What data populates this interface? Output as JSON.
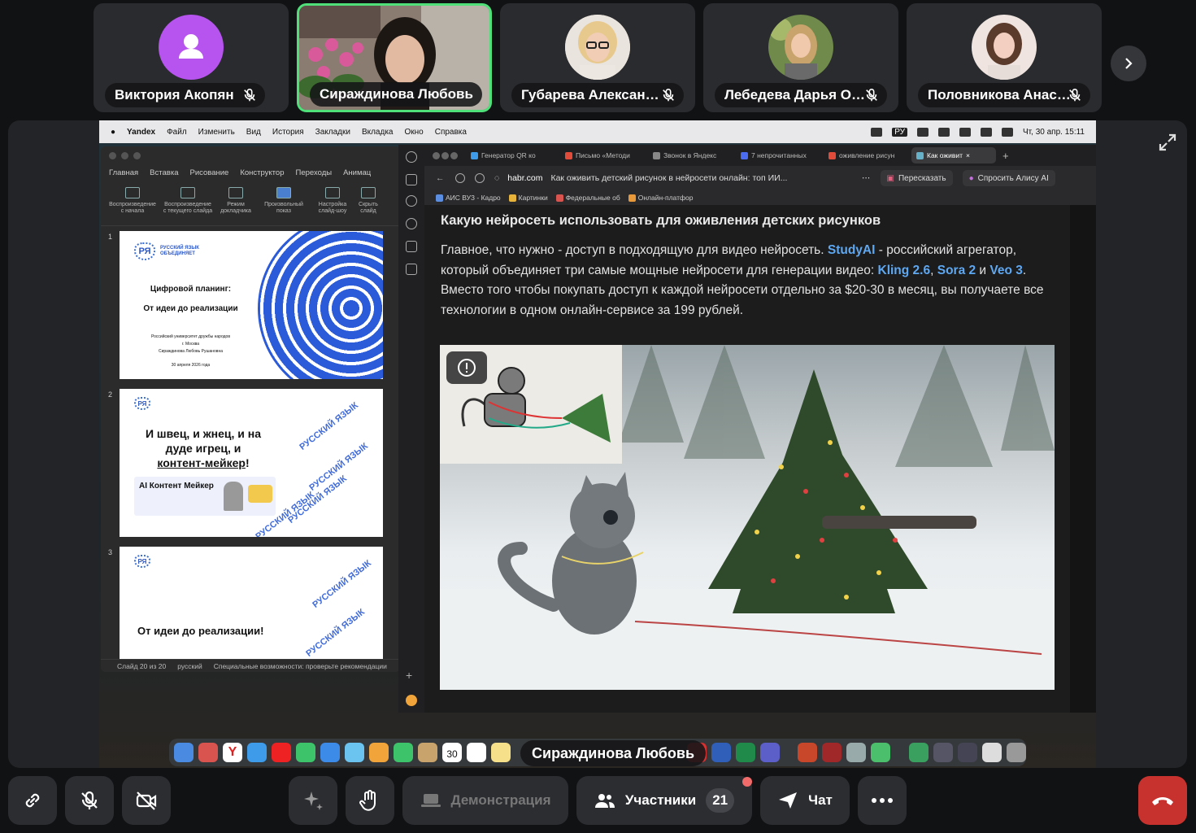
{
  "participants": [
    {
      "name": "Виктория Акопян",
      "avatar_color": "#b754f0",
      "has_photo": false
    },
    {
      "name": "Сираждинова Любовь",
      "active": true
    },
    {
      "name": "Губарева Алексан…"
    },
    {
      "name": "Лебедева Дарья О…"
    },
    {
      "name": "Половникова Анас…"
    }
  ],
  "menubar": {
    "apple": "",
    "items": [
      "Yandex",
      "Файл",
      "Изменить",
      "Вид",
      "История",
      "Закладки",
      "Вкладка",
      "Окно",
      "Справка"
    ],
    "lang": "РУ",
    "datetime": "Чт, 30 апр.  15:11"
  },
  "ppt": {
    "tabs": [
      "Главная",
      "Вставка",
      "Рисование",
      "Конструктор",
      "Переходы",
      "Анимац"
    ],
    "ribbon": [
      "Воспроизведение с начала",
      "Воспроизведение с текущего слайда",
      "Режим докладчика",
      "Произвольный показ",
      "Настройка слайд-шоу",
      "Скрыть слайд"
    ],
    "slides": [
      {
        "num": "1",
        "logo": "РУССКИЙ ЯЗЫК ОБЪЕДИНЯЕТ",
        "title1": "Цифровой планинг:",
        "title2": "От идеи до реализации",
        "sub1": "Российский университет дружбы народов",
        "sub2": "г. Москва",
        "sub3": "Сираждинова Любовь Рушановна",
        "date": "30 апреля 2026 года"
      },
      {
        "num": "2",
        "line1": "И швец, и жнец, и на",
        "line2": "дуде игрец, и",
        "line3": "контент-мейкер",
        "line3_end": "!",
        "card_title": "AI Контент Мейкер",
        "wordart": "РУССКИЙ ЯЗЫК"
      },
      {
        "num": "3",
        "title": "От идеи до реализации!",
        "wordart": "РУССКИЙ ЯЗЫК"
      }
    ],
    "status": [
      "Слайд 20 из 20",
      "русский",
      "Специальные возможности: проверьте рекомендации"
    ]
  },
  "browser": {
    "tabs": [
      {
        "label": "Генератор QR ко",
        "color": "#3d9be9"
      },
      {
        "label": "Письмо «Методи",
        "color": "#e04b3a"
      },
      {
        "label": "Звонок в Яндекс",
        "color": "#888888"
      },
      {
        "label": "7 непрочитанных",
        "color": "#4b6cf0"
      },
      {
        "label": "оживление рисун",
        "color": "#e04b3a"
      },
      {
        "label": "Как оживит",
        "color": "#66b0c8",
        "current": true
      }
    ],
    "domain": "habr.com",
    "page_title": "Как оживить детский рисунок в нейросети онлайн: топ ИИ...",
    "retell": "Пересказать",
    "ask_alice": "Спросить Алису AI",
    "bookmarks": [
      "АИС ВУЗ - Кадро",
      "Картинки",
      "Федеральные об",
      "Онлайн-платфор"
    ],
    "article": {
      "heading": "Какую нейросеть использовать для оживления детских рисунков",
      "p1": "Главное, что нужно - доступ в подходящую для видео нейросеть. ",
      "l1": "StudyAI",
      "p2": " - российский агрегатор, который объединяет три самые мощные нейросети для генерации видео: ",
      "l2": "Kling 2.6",
      "p3": ", ",
      "l3": "Sora 2",
      "p4": " и ",
      "l4": "Veo 3",
      "p5": ". Вместо того чтобы покупать доступ к каждой нейросети отдельно за $20-30 в месяц, вы получаете все технологии в одном онлайн-сервисе за 199 рублей."
    }
  },
  "dock": {
    "calendar_day": "30",
    "speaker": "Сираждинова Любовь"
  },
  "controls": {
    "demo": "Демонстрация",
    "participants": "Участники",
    "participants_count": "21",
    "chat": "Чат"
  }
}
